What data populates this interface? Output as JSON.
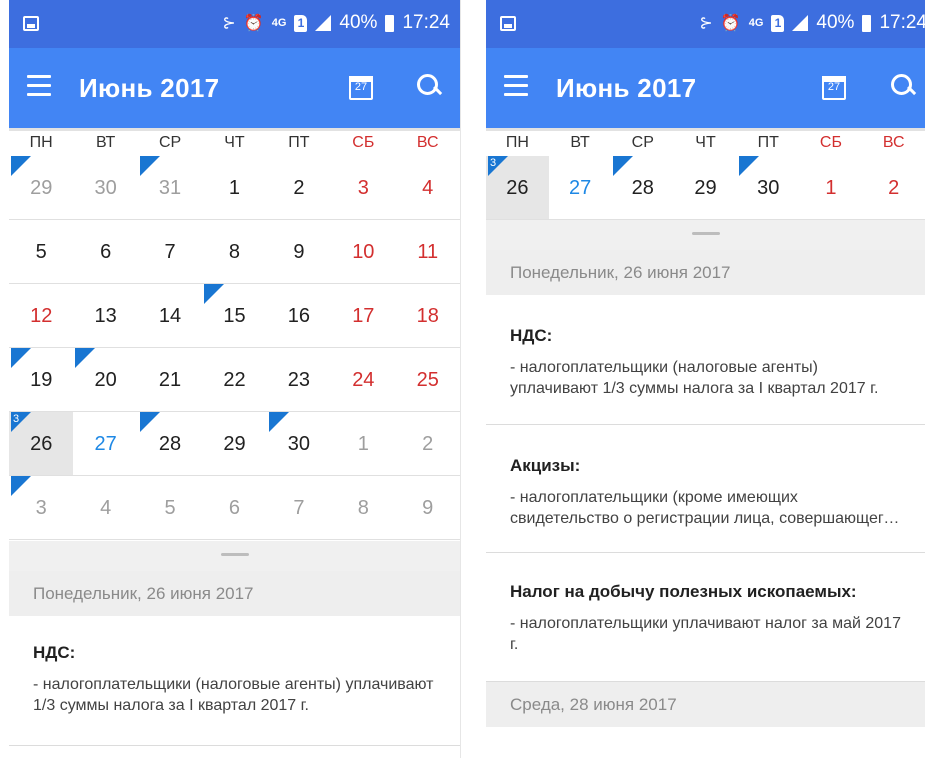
{
  "colors": {
    "status_bar": "#3d6edf",
    "app_bar": "#4285f4",
    "weekend": "#d32f2f",
    "today": "#1e88e5",
    "event_marker": "#1976d2",
    "selected_day": "#e6e6e6"
  },
  "status_bar": {
    "icons": [
      "image-icon",
      "mute-icon",
      "alarm-icon",
      "4g-icon",
      "sim-icon",
      "signal-icon",
      "battery-icon"
    ],
    "network": "4G",
    "sim": "1",
    "battery": "40%",
    "time": "17:24"
  },
  "app_bar": {
    "title": "Июнь 2017",
    "calendar_icon_day": "27"
  },
  "weekdays": [
    "ПН",
    "ВТ",
    "СР",
    "ЧТ",
    "ПТ",
    "СБ",
    "ВС"
  ],
  "month_grid": [
    [
      {
        "d": "29",
        "o": true,
        "m": true
      },
      {
        "d": "30",
        "o": true
      },
      {
        "d": "31",
        "o": true,
        "m": true
      },
      {
        "d": "1"
      },
      {
        "d": "2"
      },
      {
        "d": "3",
        "w": true
      },
      {
        "d": "4",
        "w": true
      }
    ],
    [
      {
        "d": "5"
      },
      {
        "d": "6"
      },
      {
        "d": "7"
      },
      {
        "d": "8"
      },
      {
        "d": "9"
      },
      {
        "d": "10",
        "w": true
      },
      {
        "d": "11",
        "w": true
      }
    ],
    [
      {
        "d": "12",
        "w": true
      },
      {
        "d": "13"
      },
      {
        "d": "14"
      },
      {
        "d": "15",
        "m": true
      },
      {
        "d": "16"
      },
      {
        "d": "17",
        "w": true
      },
      {
        "d": "18",
        "w": true
      }
    ],
    [
      {
        "d": "19",
        "m": true
      },
      {
        "d": "20",
        "m": true
      },
      {
        "d": "21"
      },
      {
        "d": "22"
      },
      {
        "d": "23"
      },
      {
        "d": "24",
        "w": true
      },
      {
        "d": "25",
        "w": true
      }
    ],
    [
      {
        "d": "26",
        "m": true,
        "c": "3",
        "s": true
      },
      {
        "d": "27",
        "t": true
      },
      {
        "d": "28",
        "m": true
      },
      {
        "d": "29"
      },
      {
        "d": "30",
        "m": true
      },
      {
        "d": "1",
        "o": true,
        "w": true
      },
      {
        "d": "2",
        "o": true,
        "w": true
      }
    ],
    [
      {
        "d": "3",
        "o": true,
        "m": true
      },
      {
        "d": "4",
        "o": true
      },
      {
        "d": "5",
        "o": true
      },
      {
        "d": "6",
        "o": true
      },
      {
        "d": "7",
        "o": true
      },
      {
        "d": "8",
        "o": true,
        "w": true
      },
      {
        "d": "9",
        "o": true,
        "w": true
      }
    ]
  ],
  "week_grid": [
    [
      {
        "d": "26",
        "m": true,
        "c": "3",
        "s": true
      },
      {
        "d": "27",
        "t": true
      },
      {
        "d": "28",
        "m": true
      },
      {
        "d": "29"
      },
      {
        "d": "30",
        "m": true
      },
      {
        "d": "1",
        "w": true
      },
      {
        "d": "2",
        "w": true
      }
    ]
  ],
  "left_list": {
    "date_header": "Понедельник, 26 июня 2017",
    "events": [
      {
        "title": "НДС:",
        "description": "- налогоплательщики (налоговые агенты) уплачивают 1/3 суммы налога за I квартал 2017 г."
      }
    ]
  },
  "right_list": {
    "date_header_1": "Понедельник, 26 июня 2017",
    "events": [
      {
        "title": "НДС:",
        "description": "- налогоплательщики (налоговые агенты) уплачивают 1/3 суммы налога за I квартал 2017 г."
      },
      {
        "title": "Акцизы:",
        "description": "- налогоплательщики (кроме имеющих свидетельство о регистрации лица, совершающего операции)"
      },
      {
        "title": "Налог на добычу полезных ископаемых:",
        "description": "- налогоплательщики уплачивают налог за май 2017 г."
      }
    ],
    "date_header_2": "Среда, 28 июня 2017"
  }
}
